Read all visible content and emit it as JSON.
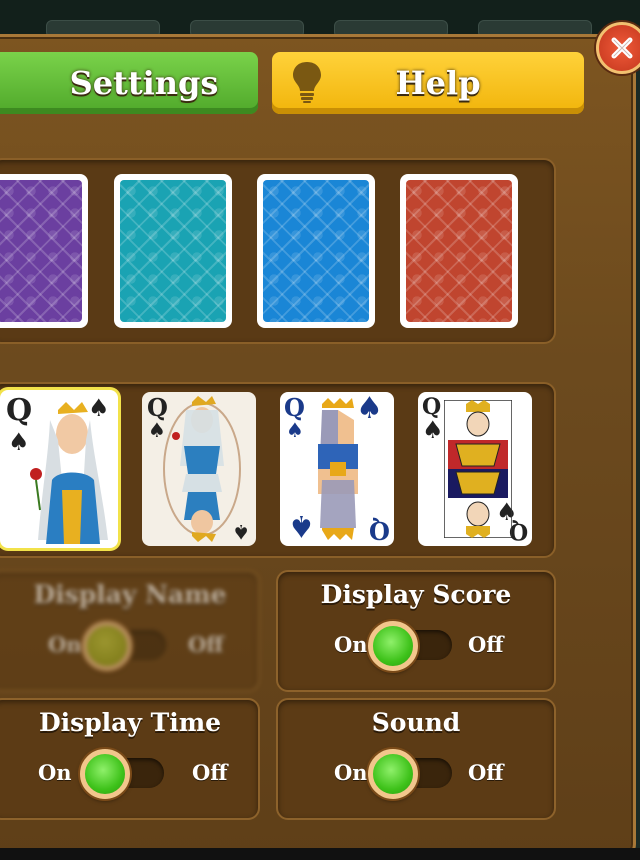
{
  "tabs": {
    "settings_label": "Settings",
    "help_label": "Help"
  },
  "card_backs": [
    {
      "name": "purple",
      "color": "#6b3fa0"
    },
    {
      "name": "teal",
      "color": "#1aa3b3"
    },
    {
      "name": "blue",
      "color": "#1a86d6"
    },
    {
      "name": "red",
      "color": "#c0452f"
    }
  ],
  "card_faces": [
    {
      "rank": "Q",
      "suit": "♠",
      "style": "classic-illustrated",
      "selected": true
    },
    {
      "rank": "Q",
      "suit": "♠",
      "style": "vintage-illustrated",
      "selected": false
    },
    {
      "rank": "Q",
      "suit": "♠",
      "style": "modern",
      "selected": false
    },
    {
      "rank": "Q",
      "suit": "♠",
      "style": "traditional",
      "selected": false
    }
  ],
  "toggles": {
    "hidden": {
      "label": "Display Name",
      "on": "On",
      "off": "Off",
      "state": "on"
    },
    "score": {
      "label": "Display Score",
      "on": "On",
      "off": "Off",
      "state": "on"
    },
    "time": {
      "label": "Display Time",
      "on": "On",
      "off": "Off",
      "state": "on"
    },
    "sound": {
      "label": "Sound",
      "on": "On",
      "off": "Off",
      "state": "on"
    }
  },
  "colors": {
    "settings_tab": "#5cb832",
    "help_tab": "#f5bd14",
    "panel": "#6c4a1e",
    "knob": "#3ec21a",
    "close": "#d9452a"
  },
  "icons": [
    "lightbulb-icon",
    "close-icon",
    "spade-icon"
  ]
}
